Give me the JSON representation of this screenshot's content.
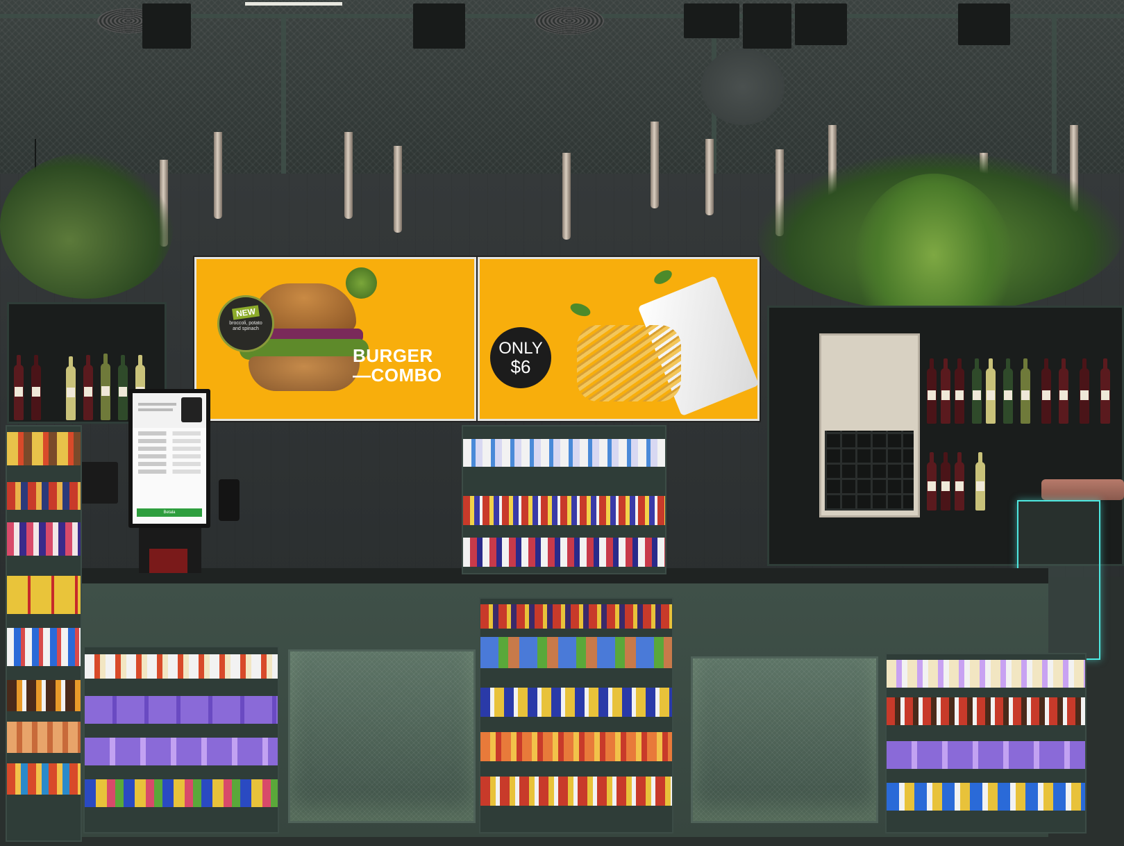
{
  "scene": "Convenience store checkout counter with digital menu boards",
  "menu_board_left": {
    "badge_title": "NEW",
    "badge_text": "broccoli, potato and spinach",
    "headline_line1": "BURGER",
    "headline_line2": "—COMBO",
    "background_color": "#f8ae0c"
  },
  "menu_board_right": {
    "price_line1": "ONLY",
    "price_line2": "$6",
    "background_color": "#f8ae0c"
  },
  "kiosk": {
    "pay_label": "Betala"
  },
  "colors": {
    "fixture_green": "#2f3d38",
    "counter_green": "#3f5048",
    "mesh_glow": "#5d7466",
    "accent_cyan": "#4ee8e0"
  }
}
